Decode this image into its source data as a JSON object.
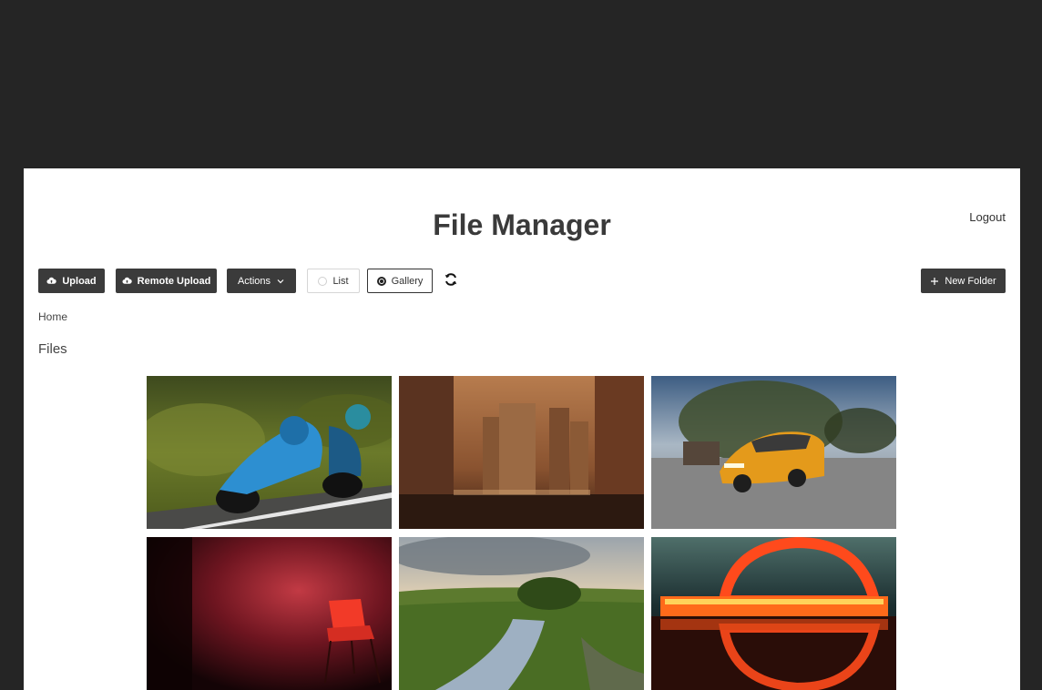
{
  "app": {
    "title": "File Manager",
    "logout_label": "Logout"
  },
  "toolbar": {
    "upload_label": "Upload",
    "remote_upload_label": "Remote Upload",
    "actions_label": "Actions",
    "list_label": "List",
    "gallery_label": "Gallery",
    "view_mode": "gallery",
    "new_folder_label": "New Folder",
    "icons": {
      "upload": "cloud-upload-icon",
      "remote_upload": "cloud-upload-icon",
      "actions": "chevron-down-icon",
      "refresh": "refresh-icon",
      "new_folder": "plus-icon"
    }
  },
  "breadcrumb": {
    "home_label": "Home"
  },
  "section": {
    "files_label": "Files"
  },
  "gallery": {
    "items": [
      {
        "subject": "motorcycle-racer"
      },
      {
        "subject": "city-skyline"
      },
      {
        "subject": "orange-car"
      },
      {
        "subject": "red-chair"
      },
      {
        "subject": "river-landscape"
      },
      {
        "subject": "neon-building-reflection"
      }
    ]
  },
  "colors": {
    "background": "#252525",
    "panel": "#ffffff",
    "button_dark": "#3b3b3b",
    "text": "#3a3a3a"
  }
}
